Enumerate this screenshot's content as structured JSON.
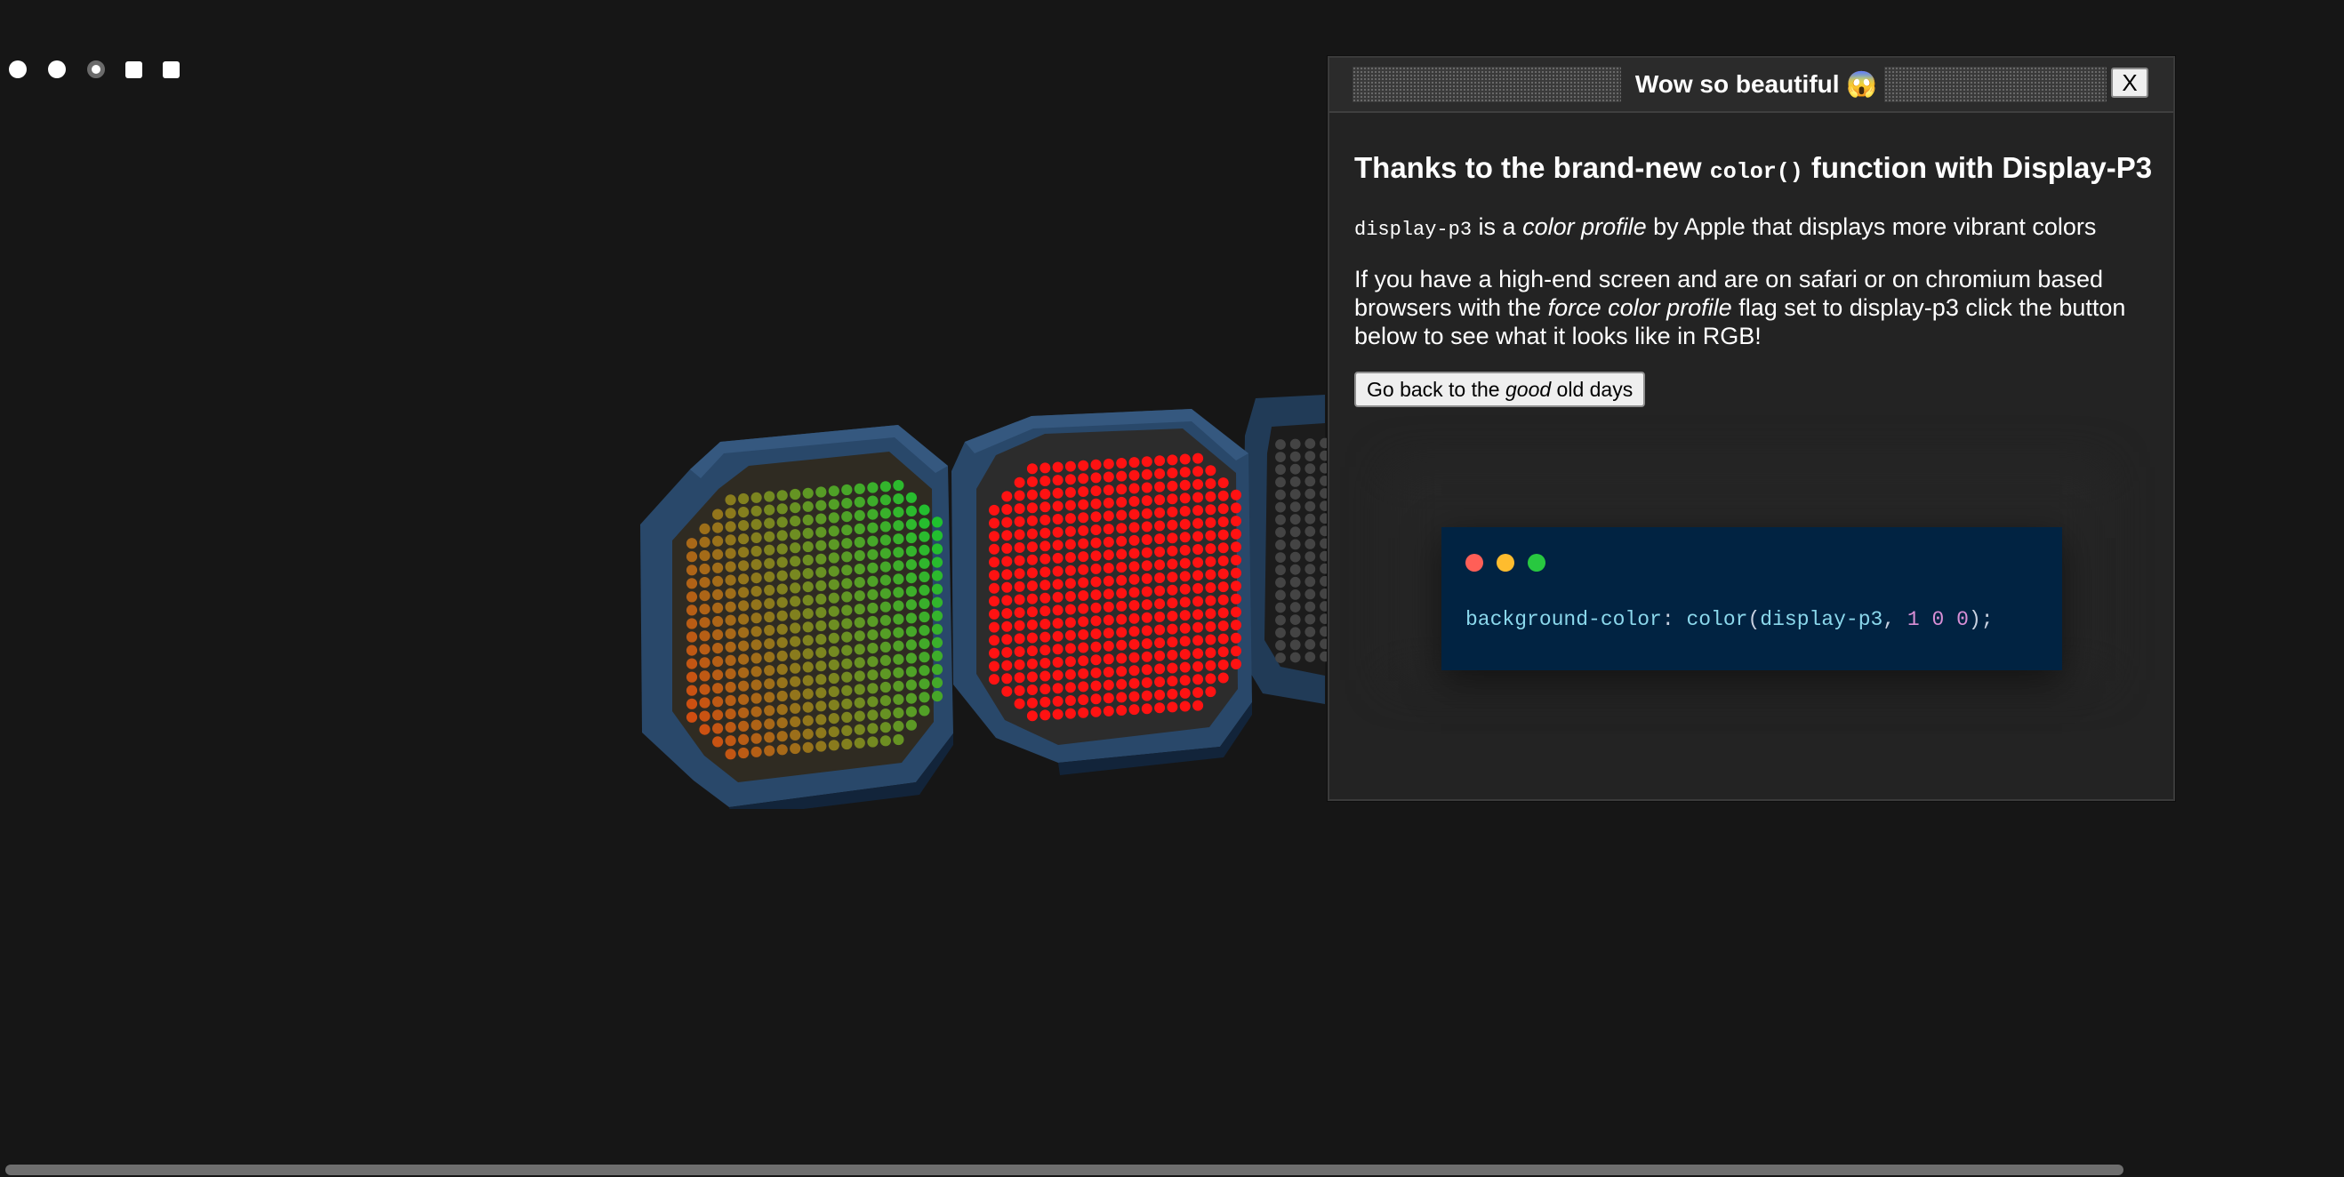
{
  "controls": [
    {
      "type": "radio",
      "checked": false
    },
    {
      "type": "radio",
      "checked": false
    },
    {
      "type": "radio",
      "checked": true
    },
    {
      "type": "checkbox",
      "checked": false
    },
    {
      "type": "checkbox",
      "checked": false
    }
  ],
  "led_panels": [
    {
      "name": "gradient-panel",
      "colors": [
        "#d9480f",
        "#16c731"
      ]
    },
    {
      "name": "red-panel",
      "colors": [
        "#ff1212",
        "#ff1212"
      ]
    },
    {
      "name": "off-panel",
      "colors": [
        "#444444",
        "#444444"
      ]
    }
  ],
  "dialog": {
    "title": "Wow so beautiful 😱",
    "close_label": "X",
    "heading_before": "Thanks to the brand-new ",
    "heading_code": "color()",
    "heading_after": " function with Display-P3",
    "p1_code": "display-p3",
    "p1_text_1": " is a ",
    "p1_em": "color profile",
    "p1_text_2": " by Apple that displays more vibrant colors",
    "p2_text_1": "If you have a high-end screen and are on safari or on chromium based browsers with the ",
    "p2_em": "force color profile",
    "p2_text_2": " flag set to display-p3 click the button below to see what it looks like in RGB!",
    "button_before": "Go back to the ",
    "button_em": "good",
    "button_after": " old days",
    "code_window": {
      "dots": [
        "#ff5f57",
        "#febc2e",
        "#28c840"
      ],
      "property": "background-color",
      "colon": ": ",
      "function": "color",
      "open_paren": "(",
      "argument": "display-p3",
      "comma": ", ",
      "values": "1 0 0",
      "close": ");"
    }
  },
  "colors": {
    "background": "#161616",
    "dialog_bg": "#232323",
    "code_bg": "#012342",
    "panel_frame": "#2a4766"
  }
}
